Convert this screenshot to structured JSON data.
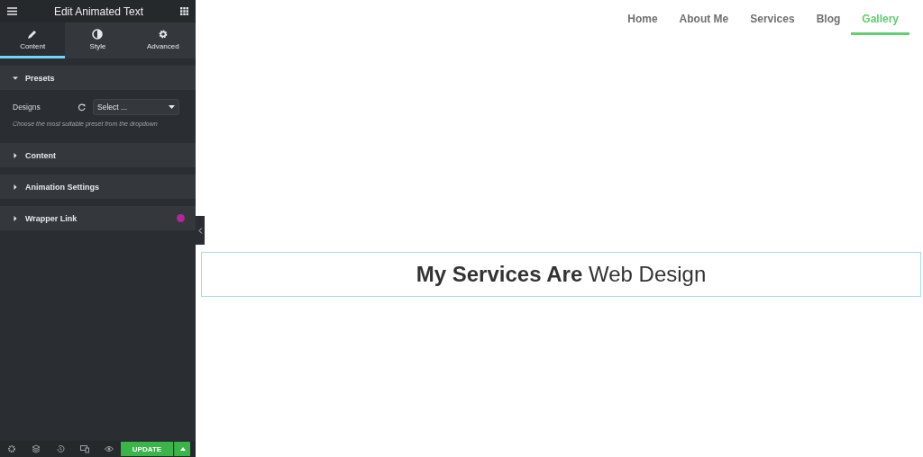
{
  "panel": {
    "title": "Edit Animated Text",
    "tabs": [
      {
        "label": "Content",
        "selected": true,
        "kind": "pencil"
      },
      {
        "label": "Style",
        "selected": false,
        "kind": "contrast"
      },
      {
        "label": "Advanced",
        "selected": false,
        "kind": "gear"
      }
    ],
    "sections": [
      {
        "title": "Presets",
        "expanded": true,
        "pro": false,
        "field": {
          "label": "Designs",
          "value": "Select ...",
          "help": "Choose the most suitable preset from the dropdown"
        }
      },
      {
        "title": "Content",
        "expanded": false,
        "pro": false
      },
      {
        "title": "Animation Settings",
        "expanded": false,
        "pro": false
      },
      {
        "title": "Wrapper Link",
        "expanded": false,
        "pro": true
      }
    ],
    "footer": {
      "update_button": "UPDATE"
    }
  },
  "nav": [
    {
      "label": "Home",
      "selected": false
    },
    {
      "label": "About Me",
      "selected": false
    },
    {
      "label": "Services",
      "selected": false
    },
    {
      "label": "Blog",
      "selected": false
    },
    {
      "label": "Gallery",
      "selected": true
    }
  ],
  "headline": "**My Services Are** Web Design"
}
